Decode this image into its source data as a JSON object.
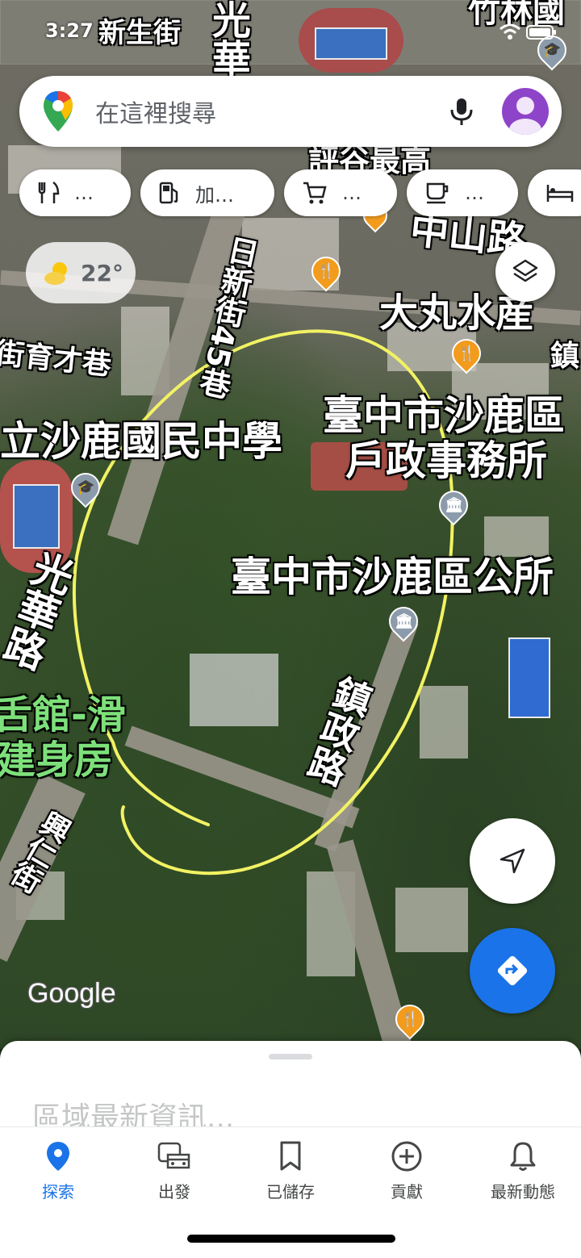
{
  "status": {
    "time": "3:27"
  },
  "search": {
    "placeholder": "在這裡搜尋"
  },
  "chips": [
    {
      "icon": "restaurant-icon",
      "label": "…"
    },
    {
      "icon": "gas-station-icon",
      "label": "加…"
    },
    {
      "icon": "shopping-cart-icon",
      "label": "…"
    },
    {
      "icon": "coffee-icon",
      "label": "…"
    },
    {
      "icon": "hotel-bed-icon",
      "label": ""
    }
  ],
  "weather": {
    "temp": "22°"
  },
  "map_labels": {
    "top_street": "新生街",
    "top_right": "竹林國",
    "guanghua_top": "光華",
    "fenggu": "評谷最高",
    "zhongshan": "中山路",
    "damaru": "大丸水産",
    "yucai": "街育才巷",
    "rixin": "日新街45巷",
    "zhen": "鎮",
    "school": "立沙鹿國民中學",
    "household_line1": "臺中市沙鹿區",
    "household_line2": "戶政事務所",
    "district_office": "臺中市沙鹿區公所",
    "guanghua_road": "光華路",
    "zhenzheng_road": "鎮政路",
    "gym_line1": "舌館-滑",
    "gym_line2": "建身房",
    "xingren": "興仁街"
  },
  "google_logo": "Google",
  "sheet": {
    "title": "區域最新資訊..."
  },
  "nav": [
    {
      "icon": "explore-pin-icon",
      "label": "探索",
      "active": true
    },
    {
      "icon": "commute-car-icon",
      "label": "出發",
      "active": false
    },
    {
      "icon": "saved-bookmark-icon",
      "label": "已儲存",
      "active": false
    },
    {
      "icon": "contribute-plus-icon",
      "label": "貢獻",
      "active": false
    },
    {
      "icon": "updates-bell-icon",
      "label": "最新動態",
      "active": false
    }
  ]
}
